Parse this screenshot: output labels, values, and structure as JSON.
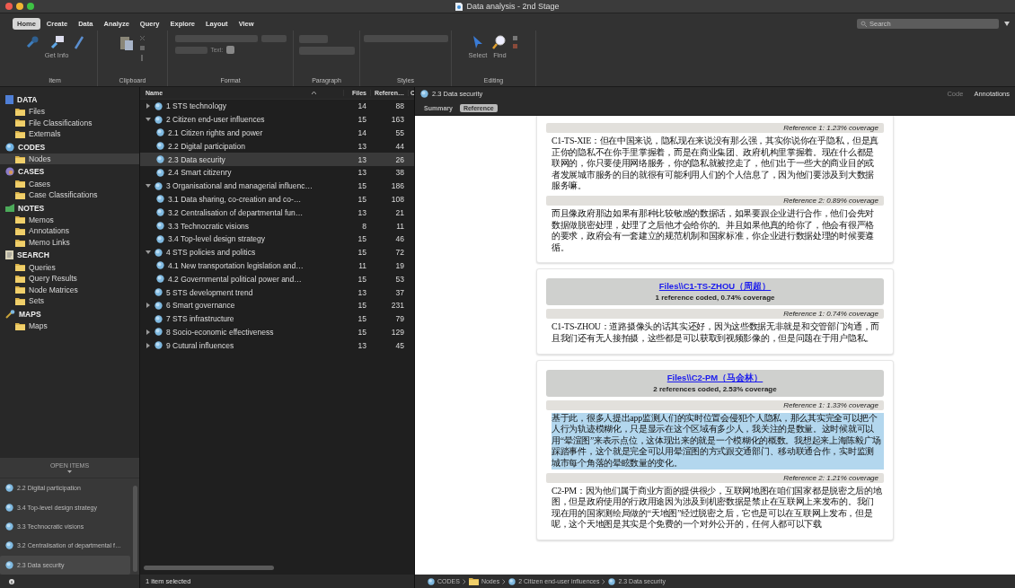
{
  "window": {
    "title": "Data analysis - 2nd Stage"
  },
  "ribbon": {
    "tabs": [
      {
        "label": "Home",
        "selected": true
      },
      {
        "label": "Create",
        "selected": false
      },
      {
        "label": "Data",
        "selected": false
      },
      {
        "label": "Analyze",
        "selected": false
      },
      {
        "label": "Query",
        "selected": false
      },
      {
        "label": "Explore",
        "selected": false
      },
      {
        "label": "Layout",
        "selected": false
      },
      {
        "label": "View",
        "selected": false
      }
    ],
    "groups": [
      {
        "kind": "item",
        "label": "Item",
        "button": "Get Info"
      },
      {
        "kind": "clipboard",
        "label": "Clipboard"
      },
      {
        "kind": "format",
        "label": "Format",
        "text_label": "Text:"
      },
      {
        "kind": "paragraph",
        "label": "Paragraph"
      },
      {
        "kind": "styles",
        "label": "Styles"
      },
      {
        "kind": "editing",
        "label": "Editing",
        "buttons": [
          "Select",
          "Find"
        ]
      }
    ],
    "search": {
      "placeholder": "Search"
    }
  },
  "sidebar": {
    "sections": [
      {
        "kind": "data",
        "title": "DATA",
        "items": [
          {
            "label": "Files",
            "selected": false
          },
          {
            "label": "File Classifications",
            "selected": false
          },
          {
            "label": "Externals",
            "selected": false
          }
        ]
      },
      {
        "kind": "codes",
        "title": "CODES",
        "items": [
          {
            "label": "Nodes",
            "selected": true
          }
        ]
      },
      {
        "kind": "cases",
        "title": "CASES",
        "items": [
          {
            "label": "Cases",
            "selected": false
          },
          {
            "label": "Case Classifications",
            "selected": false
          }
        ]
      },
      {
        "kind": "notes",
        "title": "NOTES",
        "items": [
          {
            "label": "Memos",
            "selected": false
          },
          {
            "label": "Annotations",
            "selected": false
          },
          {
            "label": "Memo Links",
            "selected": false
          }
        ]
      },
      {
        "kind": "search",
        "title": "SEARCH",
        "items": [
          {
            "label": "Queries",
            "selected": false
          },
          {
            "label": "Query Results",
            "selected": false
          },
          {
            "label": "Node Matrices",
            "selected": false
          },
          {
            "label": "Sets",
            "selected": false
          }
        ]
      },
      {
        "kind": "maps",
        "title": "MAPS",
        "items": [
          {
            "label": "Maps",
            "selected": false
          }
        ]
      }
    ]
  },
  "open_items": {
    "title": "OPEN ITEMS",
    "items": [
      {
        "label": "2.2 Digital participation",
        "selected": false
      },
      {
        "label": "3.4 Top-level design strategy",
        "selected": false
      },
      {
        "label": "3.3 Technocratic visions",
        "selected": false
      },
      {
        "label": "3.2 Centralisation of departmental f…",
        "selected": false
      },
      {
        "label": "2.3 Data security",
        "selected": true
      }
    ]
  },
  "node_list": {
    "columns": [
      "Name",
      "Files",
      "Referen…",
      "C"
    ],
    "rows": [
      {
        "name": "1 STS technology",
        "files": "14",
        "references": "88",
        "expanded": false,
        "selected": false
      },
      {
        "name": "2 Citizen end-user influences",
        "files": "15",
        "references": "163",
        "expanded": true,
        "selected": false,
        "children": [
          {
            "name": "2.1 Citizen rights and power",
            "files": "14",
            "references": "55",
            "selected": false
          },
          {
            "name": "2.2 Digital participation",
            "files": "13",
            "references": "44",
            "selected": false
          },
          {
            "name": "2.3 Data security",
            "files": "13",
            "references": "26",
            "selected": true
          },
          {
            "name": "2.4 Smart citizenry",
            "files": "13",
            "references": "38",
            "selected": false
          }
        ]
      },
      {
        "name": "3 Organisational and managerial influenc…",
        "files": "15",
        "references": "186",
        "expanded": true,
        "selected": false,
        "children": [
          {
            "name": "3.1 Data sharing, co-creation and co-…",
            "files": "15",
            "references": "108",
            "selected": false
          },
          {
            "name": "3.2 Centralisation of departmental fun…",
            "files": "13",
            "references": "21",
            "selected": false
          },
          {
            "name": "3.3 Technocratic visions",
            "files": "8",
            "references": "11",
            "selected": false
          },
          {
            "name": "3.4 Top-level design strategy",
            "files": "15",
            "references": "46",
            "selected": false
          }
        ]
      },
      {
        "name": "4 STS policies and politics",
        "files": "15",
        "references": "72",
        "expanded": true,
        "selected": false,
        "children": [
          {
            "name": "4.1 New transportation legislation and…",
            "files": "11",
            "references": "19",
            "selected": false
          },
          {
            "name": "4.2 Governmental political power and…",
            "files": "15",
            "references": "53",
            "selected": false
          }
        ]
      },
      {
        "name": "5 STS development trend",
        "files": "13",
        "references": "37",
        "selected": false
      },
      {
        "name": "6 Smart governance",
        "files": "15",
        "references": "231",
        "expanded": false,
        "selected": false
      },
      {
        "name": "7 STS infrastructure",
        "files": "15",
        "references": "79",
        "selected": false
      },
      {
        "name": "8 Socio-economic effectiveness",
        "files": "15",
        "references": "129",
        "expanded": false,
        "selected": false
      },
      {
        "name": "9 Cutural influences",
        "files": "13",
        "references": "45",
        "expanded": false,
        "selected": false
      }
    ],
    "status": "1 item selected"
  },
  "detail": {
    "title": "2.3 Data security",
    "actions": [
      {
        "label": "Code",
        "disabled": true
      },
      {
        "label": "Annotations",
        "disabled": false
      }
    ],
    "tabs": [
      {
        "label": "Summary",
        "selected": false
      },
      {
        "label": "Reference",
        "selected": true
      }
    ],
    "cards": [
      {
        "references": [
          {
            "heading": "Reference 1: 1.23% coverage",
            "selected": false,
            "text": "C1-TS-XIE：但在中国来说，隐私现在来说没有那么强，其实你说你在乎隐私，但是真正你的隐私不在你手里掌握着，而是在商业集团、政府机构里掌握着。现在什么都是联网的，你只要使用网络服务，你的隐私就被挖走了，他们出于一些大的商业目的或者发展城市服务的目的就很有可能利用人们的个人信息了，因为他们要涉及到大数据服务嘛。"
          },
          {
            "heading": "Reference 2: 0.89% coverage",
            "selected": false,
            "text": "而且像政府那边如果有那种比较敏感的数据话，如果要跟企业进行合作，他们会先对数据做脱密处理，处理了之后他才会给你的。并且如果他真的给你了，他会有很严格的要求，政府会有一套建立的规范机制和国家标准，你企业进行数据处理的时候要遵循。"
          }
        ]
      },
      {
        "file": "Files\\\\C1-TS-ZHOU（周超）",
        "summary": "1 reference coded, 0.74% coverage",
        "references": [
          {
            "heading": "Reference 1: 0.74% coverage",
            "selected": false,
            "text": "C1-TS-ZHOU：道路摄像头的话其实还好，因为这些数据无非就是和交管部门沟通，而且我们还有无人接拍摄，这些都是可以获取到视频影像的，但是问题在于用户隐私。"
          }
        ]
      },
      {
        "file": "Files\\\\C2-PM（马会林）",
        "summary": "2 references coded, 2.53% coverage",
        "references": [
          {
            "heading": "Reference 1: 1.33% coverage",
            "selected": true,
            "text": "基于此，很多人提出app监测人们的实时位置会侵犯个人隐私，那么其实完全可以把个人行为轨迹模糊化，只是显示在这个区域有多少人，我关注的是数量。这时候就可以用“晕渲图”来表示点位，这体现出来的就是一个模糊化的概数。我想起来上海陈毅广场踩踏事件，这个就是完全可以用晕渲图的方式跟交通部门、移动联通合作，实时监测城市每个角落的晕眩数量的变化。"
          },
          {
            "heading": "Reference 2: 1.21% coverage",
            "selected": false,
            "text": "C2-PM：因为他们属于商业方面的提供很少，互联网地图在咱们国家都是脱密之后的地图，但是政府使用的行政用途因为涉及到机密数据是禁止在互联网上来发布的。我们现在用的国家测绘局做的“天地图”经过脱密之后，它也是可以在互联网上发布，但是呢，这个天地图是其实是个免费的一个对外公开的，任何人都可以下载"
          }
        ]
      }
    ],
    "breadcrumb": [
      {
        "label": "CODES",
        "kind": "section"
      },
      {
        "label": "Nodes",
        "kind": "folder"
      },
      {
        "label": "2 Citizen end-user influences",
        "kind": "node"
      },
      {
        "label": "2.3 Data security",
        "kind": "node"
      }
    ]
  }
}
